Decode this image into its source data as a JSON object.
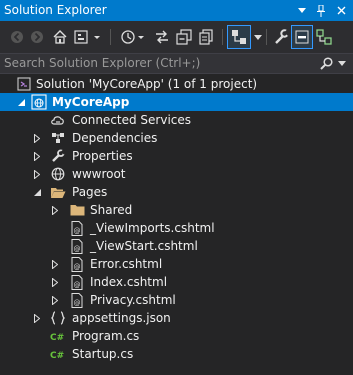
{
  "window": {
    "title": "Solution Explorer",
    "dropdown_icon": "chevron-down-icon",
    "pin_icon": "pin-icon",
    "close_icon": "close-icon"
  },
  "toolbar": {
    "icons": [
      "back-icon",
      "forward-icon",
      "home-icon",
      "switch-views-icon",
      "history-icon",
      "sync-icon",
      "collapse-all-icon",
      "show-all-files-icon",
      "preview-selected-icon",
      "properties-icon",
      "pin-active-icon",
      "view-class-diagram-icon"
    ]
  },
  "search": {
    "placeholder": "Search Solution Explorer (Ctrl+;)",
    "value": ""
  },
  "tree": {
    "solution": {
      "label": "Solution 'MyCoreApp' (1 of 1 project)"
    },
    "project": {
      "label": "MyCoreApp"
    },
    "items": {
      "connected_services": "Connected Services",
      "dependencies": "Dependencies",
      "properties": "Properties",
      "wwwroot": "wwwroot",
      "pages": "Pages",
      "shared": "Shared",
      "viewimports": "_ViewImports.cshtml",
      "viewstart": "_ViewStart.cshtml",
      "error": "Error.cshtml",
      "index": "Index.cshtml",
      "privacy": "Privacy.cshtml",
      "appsettings": "appsettings.json",
      "program": "Program.cs",
      "startup": "Startup.cs"
    }
  },
  "colors": {
    "accent": "#007acc",
    "background": "#252526",
    "toolbar": "#2d2d30",
    "folder": "#dcb67a",
    "csharp": "#68c43c"
  }
}
